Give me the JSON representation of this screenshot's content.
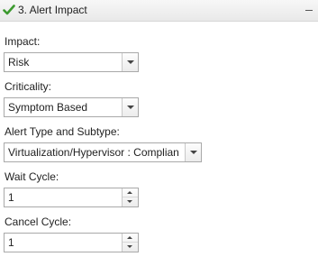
{
  "section": {
    "title": "3. Alert Impact",
    "status_icon": "check-icon",
    "collapse_icon": "minimize-icon",
    "check_color": "#3c9a2f"
  },
  "fields": {
    "impact": {
      "label": "Impact:",
      "value": "Risk"
    },
    "criticality": {
      "label": "Criticality:",
      "value": "Symptom Based"
    },
    "alert_type": {
      "label": "Alert Type and Subtype:",
      "value": "Virtualization/Hypervisor : Complian"
    },
    "wait_cycle": {
      "label": "Wait Cycle:",
      "value": "1"
    },
    "cancel_cycle": {
      "label": "Cancel Cycle:",
      "value": "1"
    }
  }
}
